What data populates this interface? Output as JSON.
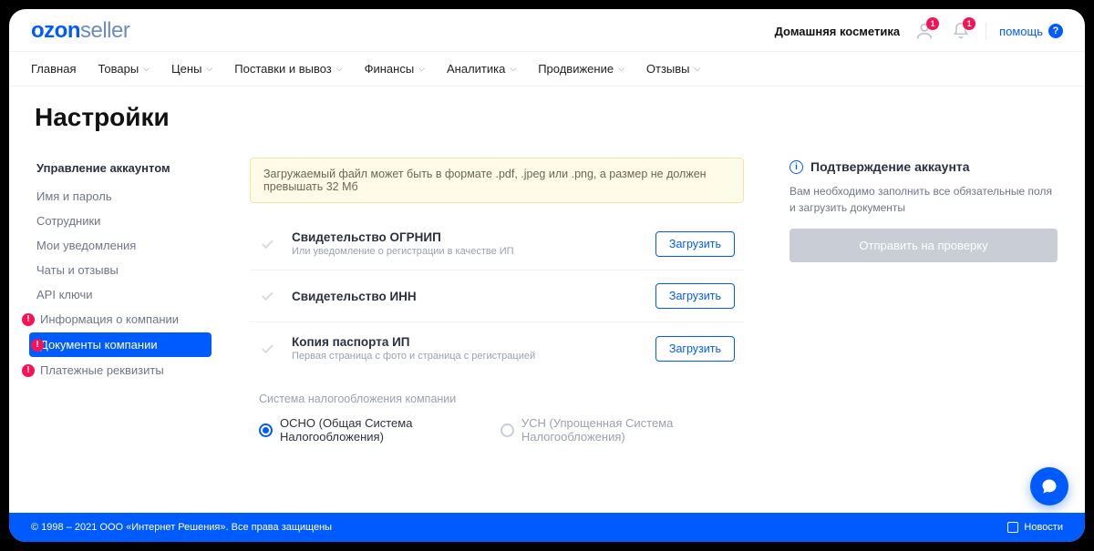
{
  "brand": {
    "ozon": "ozon",
    "seller": "seller"
  },
  "header": {
    "company": "Домашняя косметика",
    "avatar_badge": "1",
    "bell_badge": "1",
    "help": "помощь"
  },
  "nav": {
    "items": [
      {
        "label": "Главная",
        "dropdown": false
      },
      {
        "label": "Товары",
        "dropdown": true
      },
      {
        "label": "Цены",
        "dropdown": true
      },
      {
        "label": "Поставки и вывоз",
        "dropdown": true
      },
      {
        "label": "Финансы",
        "dropdown": true
      },
      {
        "label": "Аналитика",
        "dropdown": true
      },
      {
        "label": "Продвижение",
        "dropdown": true
      },
      {
        "label": "Отзывы",
        "dropdown": true
      }
    ]
  },
  "page_title": "Настройки",
  "sidebar": {
    "title": "Управление аккаунтом",
    "items": [
      {
        "label": "Имя и пароль",
        "warn": false,
        "active": false
      },
      {
        "label": "Сотрудники",
        "warn": false,
        "active": false
      },
      {
        "label": "Мои уведомления",
        "warn": false,
        "active": false
      },
      {
        "label": "Чаты и отзывы",
        "warn": false,
        "active": false
      },
      {
        "label": "API ключи",
        "warn": false,
        "active": false
      },
      {
        "label": "Информация о компании",
        "warn": true,
        "active": false
      },
      {
        "label": "Документы компании",
        "warn": true,
        "active": true
      },
      {
        "label": "Платежные реквизиты",
        "warn": true,
        "active": false
      }
    ]
  },
  "main": {
    "alert": "Загружаемый файл может быть в формате .pdf, .jpeg или .png, а размер не должен превышать 32 Мб",
    "upload_label": "Загрузить",
    "docs": [
      {
        "title": "Свидетельство ОГРНИП",
        "sub": "Или уведомление о регистрации в качестве ИП"
      },
      {
        "title": "Свидетельство ИНН",
        "sub": ""
      },
      {
        "title": "Копия паспорта ИП",
        "sub": "Первая страница с фото и страница с регистрацией"
      }
    ],
    "tax_label": "Система налогообложения компании",
    "tax_options": [
      {
        "label": "ОСНО (Общая Система Налогообложения)",
        "checked": true
      },
      {
        "label": "УСН (Упрощенная Система Налогообложения)",
        "checked": false
      }
    ]
  },
  "right": {
    "title": "Подтверждение аккаунта",
    "text": "Вам необходимо заполнить все обязательные поля и загрузить документы",
    "submit": "Отправить на проверку"
  },
  "footer": {
    "copyright": "© 1998 – 2021 ООО «Интернет Решения». Все права защищены",
    "news": "Новости"
  }
}
